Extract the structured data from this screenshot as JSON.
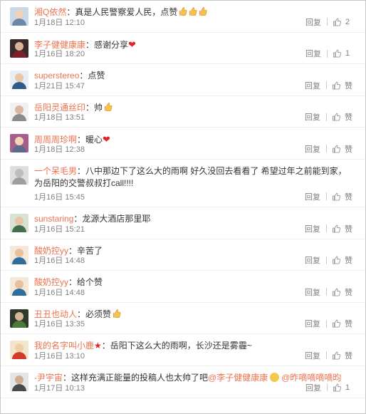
{
  "labels": {
    "reply": "回复",
    "like": "赞"
  },
  "comments": [
    {
      "user": "湘Q依然",
      "text": "：真是人民警察爱人民，点赞",
      "emoji": "thumbs-up x3",
      "time": "1月18日 12:10",
      "likes": "2",
      "avatar": {
        "bg": "#c7d9e8",
        "head": "#f1d0b4",
        "body": "#6b86a6"
      }
    },
    {
      "user": "李子健健康康",
      "text": "：感谢分享",
      "emoji": "heart",
      "time": "1月16日 18:20",
      "likes": "1",
      "avatar": {
        "bg": "#3a2a2a",
        "head": "#d9b39a",
        "body": "#7a1f2b"
      }
    },
    {
      "user": "superstereo",
      "text": "：点赞",
      "emoji": "",
      "time": "1月21日 15:47",
      "likes": "",
      "avatar": {
        "bg": "#e6edf4",
        "head": "#e9c7a6",
        "body": "#2f5a8a"
      }
    },
    {
      "user": "岳阳灵通丝印",
      "text": "：帅",
      "emoji": "thumbs-up",
      "time": "1月18日 13:51",
      "likes": "",
      "avatar": {
        "bg": "#f1f1f1",
        "head": "#d9b7a0",
        "body": "#8c8c8c"
      }
    },
    {
      "user": "周周周珍啊",
      "text": "：暖心",
      "emoji": "heart",
      "time": "1月18日 12:38",
      "likes": "",
      "avatar": {
        "bg": "#a65e8c",
        "head": "#f3d5b8",
        "body": "#5b6b8b"
      }
    },
    {
      "user": "一个呆毛男",
      "text": "：八中那边下了这么大的雨啊 好久没回去看看了 希望过年之前能到家， 为岳阳的交警叔叔打call!!!!",
      "emoji": "",
      "time": "1月16日 15:45",
      "likes": "",
      "tall": true,
      "avatar": {
        "bg": "#dedede",
        "head": "#bdbdbd",
        "body": "#9e9e9e"
      }
    },
    {
      "user": "sunstaring",
      "text": "：龙源大酒店那里耶",
      "emoji": "",
      "time": "1月16日 15:21",
      "likes": "",
      "avatar": {
        "bg": "#d7e3d2",
        "head": "#e7c6a7",
        "body": "#3f6f4f"
      }
    },
    {
      "user": "酸奶控yy",
      "text": "：辛苦了",
      "emoji": "",
      "time": "1月16日 14:48",
      "likes": "",
      "avatar": {
        "bg": "#f4e8d8",
        "head": "#e8c19c",
        "body": "#2e6e9e"
      }
    },
    {
      "user": "酸奶控yy",
      "text": "：给个赞",
      "emoji": "",
      "time": "1月16日 14:48",
      "likes": "",
      "avatar": {
        "bg": "#f4e8d8",
        "head": "#e8c19c",
        "body": "#2e6e9e"
      }
    },
    {
      "user": "丑丑也动人",
      "text": "：必须赞",
      "emoji": "thumbs-up",
      "time": "1月16日 13:35",
      "likes": "",
      "avatar": {
        "bg": "#2f3a2a",
        "head": "#d8b59a",
        "body": "#4d7a3a"
      }
    },
    {
      "user": "我的名字叫小鹿",
      "text": "：岳阳下这么大的雨啊，长沙还是雾霾~",
      "emoji": "star",
      "time": "1月16日 13:10",
      "likes": "",
      "avatar": {
        "bg": "#f2e6cc",
        "head": "#f0cfa8",
        "body": "#d43a2a"
      }
    },
    {
      "user": "-尹宇宙",
      "text": "：这样充满正能量的投稿人也太帅了吧",
      "mention1": "@李子健健康康",
      "mention2": "@昨嘀嘀嘀嘀昀",
      "emoji": "face",
      "time": "1月17日 10:13",
      "likes": "1",
      "avatar": {
        "bg": "#e5e5e5",
        "head": "#cfae94",
        "body": "#4a4a4a"
      }
    }
  ]
}
